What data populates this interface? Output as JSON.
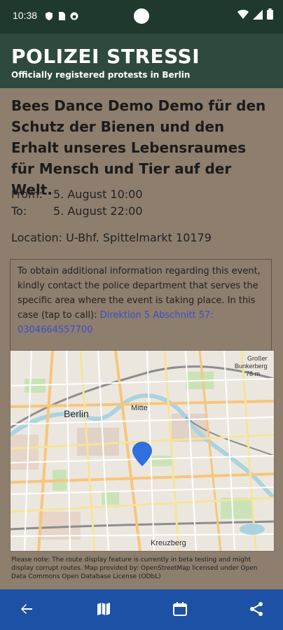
{
  "status_bar": {
    "time": "10:38",
    "icons": [
      "shield-icon",
      "sim-icon",
      "data-icon"
    ],
    "right_icons": [
      "wifi-icon",
      "signal-icon",
      "battery-icon"
    ]
  },
  "app_bar": {
    "title": "POLIZEI STRESSI",
    "subtitle": "Officially registered protests in Berlin"
  },
  "event": {
    "title": "Bees Dance Demo Demo für den Schutz der Bienen und den Erhalt unseres  Lebensraumes für Mensch und Tier auf der Welt.",
    "from_label": "From:",
    "from_value": "5. August 10:00",
    "to_label": "To:",
    "to_value": "5. August 22:00",
    "location": "Location: U-Bhf. Spittelmarkt 10179"
  },
  "info": {
    "text": "To obtain additional information regarding this event, kindly contact the police department that serves the specific area where the event is taking place. In this case (tap to call): ",
    "link": "Direktion 5 Abschnitt 57: 0304664557700"
  },
  "map": {
    "labels": {
      "berlin": "Berlin",
      "mitte": "Mitte",
      "kreuzberg": "Kreuzberg",
      "grosser": "Großer",
      "bunkerberg": "Bunkerberg",
      "height": "78 m"
    }
  },
  "note": "Please note: The route display feature is currently in beta testing and might display corrupt routes. Map provided by: OpenStreetMap licensed under Open Data Commons Open Database License (ODbL)",
  "bottom_nav": {
    "items": [
      "back-icon",
      "map-icon",
      "calendar-icon",
      "share-icon"
    ]
  },
  "colors": {
    "background": "#8d7e6e",
    "status_bar": "#1f3a2d",
    "app_bar": "#2e4a3c",
    "bottom_nav": "#1d51a5",
    "link": "#3a4fc7",
    "marker": "#2f6fe0"
  }
}
